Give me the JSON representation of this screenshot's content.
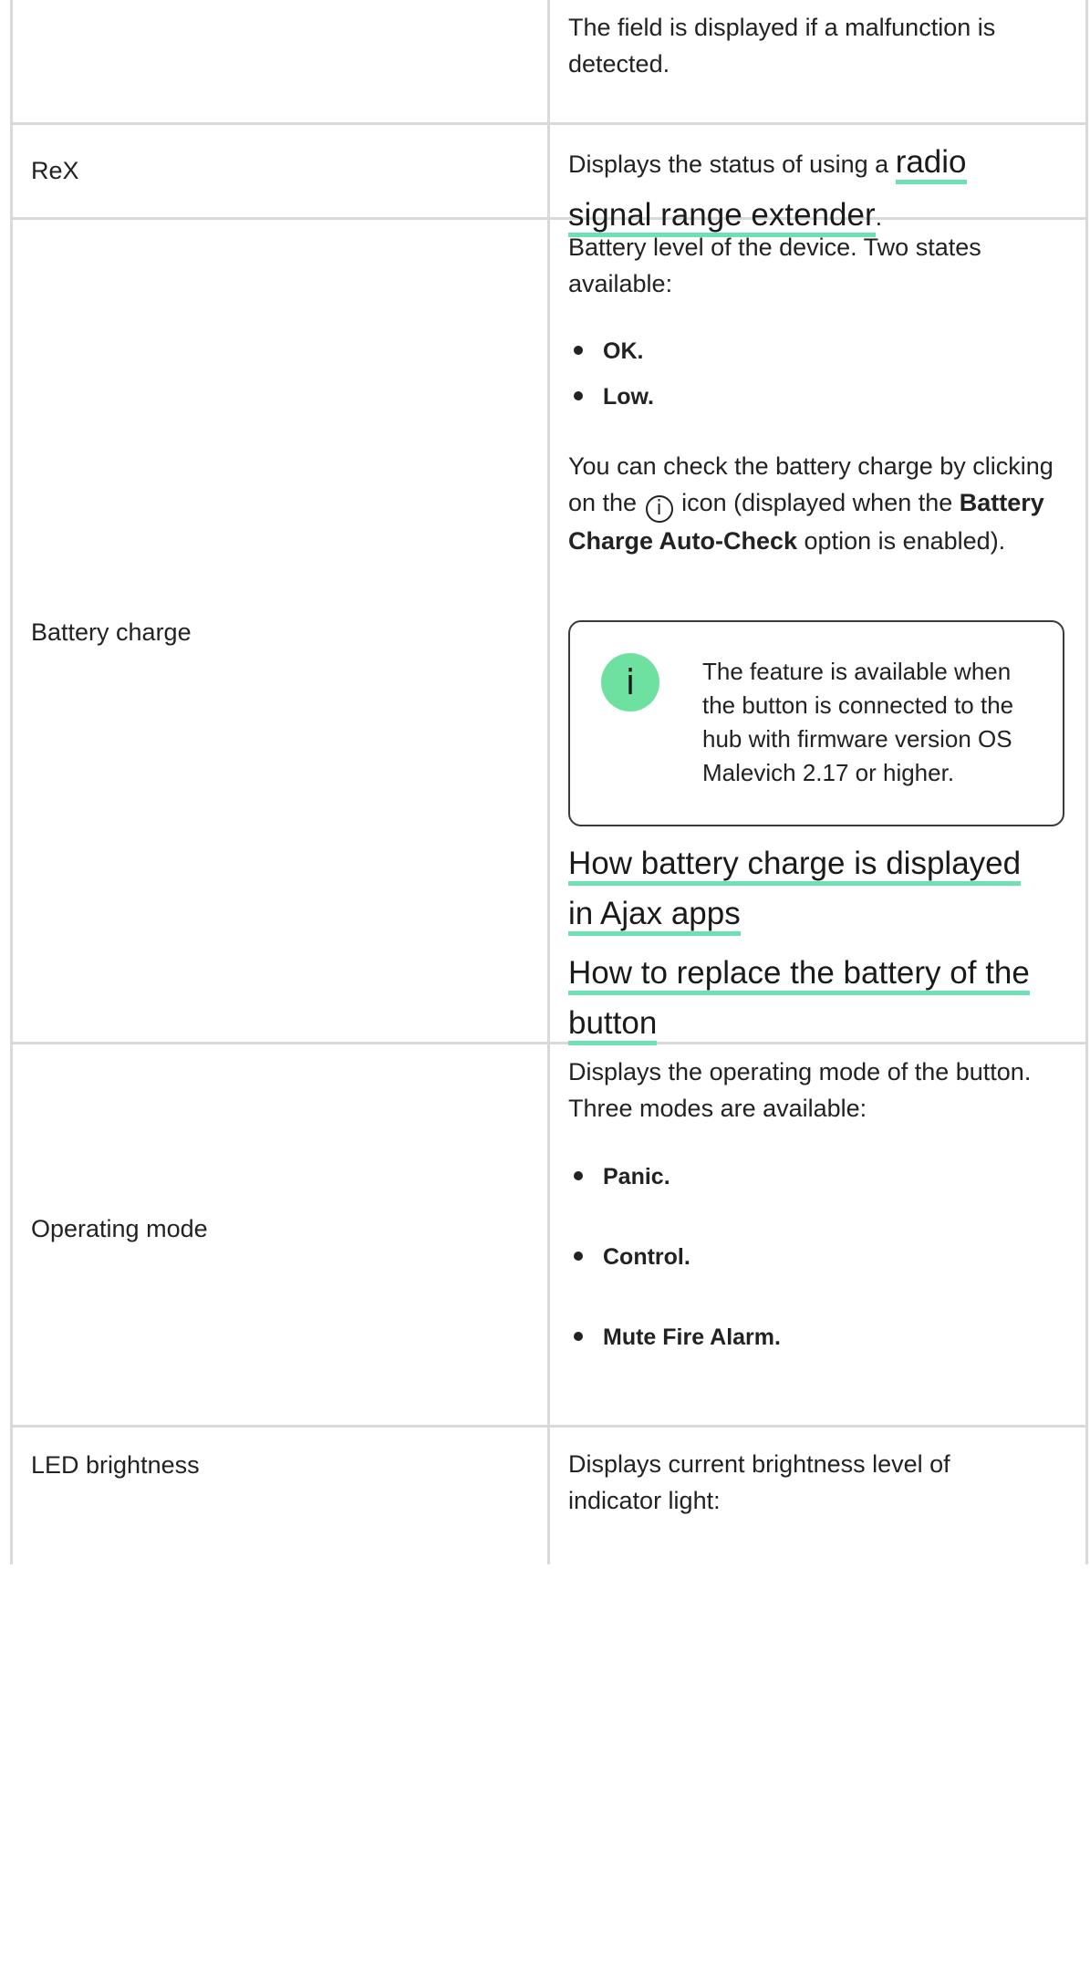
{
  "rows": {
    "malfunction": {
      "label": "",
      "text": "The field is displayed if a malfunction is detected."
    },
    "rex": {
      "label": "ReX",
      "text_before": "Displays the status of using a ",
      "link": "radio signal range extender",
      "text_after": "."
    },
    "battery": {
      "label": "Battery charge",
      "intro": "Battery level of the device. Two states available:",
      "states": [
        "OK.",
        "Low."
      ],
      "check_before": "You can check the battery charge by clicking on the ",
      "check_icon": "i",
      "check_middle": " icon (displayed when the ",
      "check_bold": "Battery Charge Auto-Check",
      "check_after": " option is enabled).",
      "note_icon": "i",
      "note_text": "The feature is available when the button is connected to the hub with firmware version OS Malevich 2.17 or higher.",
      "link_display": "How battery charge is displayed in Ajax apps",
      "link_replace": "How to replace the battery of the button"
    },
    "operating_mode": {
      "label": "Operating mode",
      "intro": "Displays the operating mode of the button. Three modes are available:",
      "modes": [
        "Panic.",
        "Control.",
        "Mute Fire Alarm."
      ]
    },
    "led": {
      "label": "LED brightness",
      "text": "Displays current brightness level of indicator light:"
    }
  },
  "colors": {
    "accent_underline": "#6ee0b3",
    "info_icon_fill": "#6ee0a0",
    "border": "#d9d9d9"
  }
}
